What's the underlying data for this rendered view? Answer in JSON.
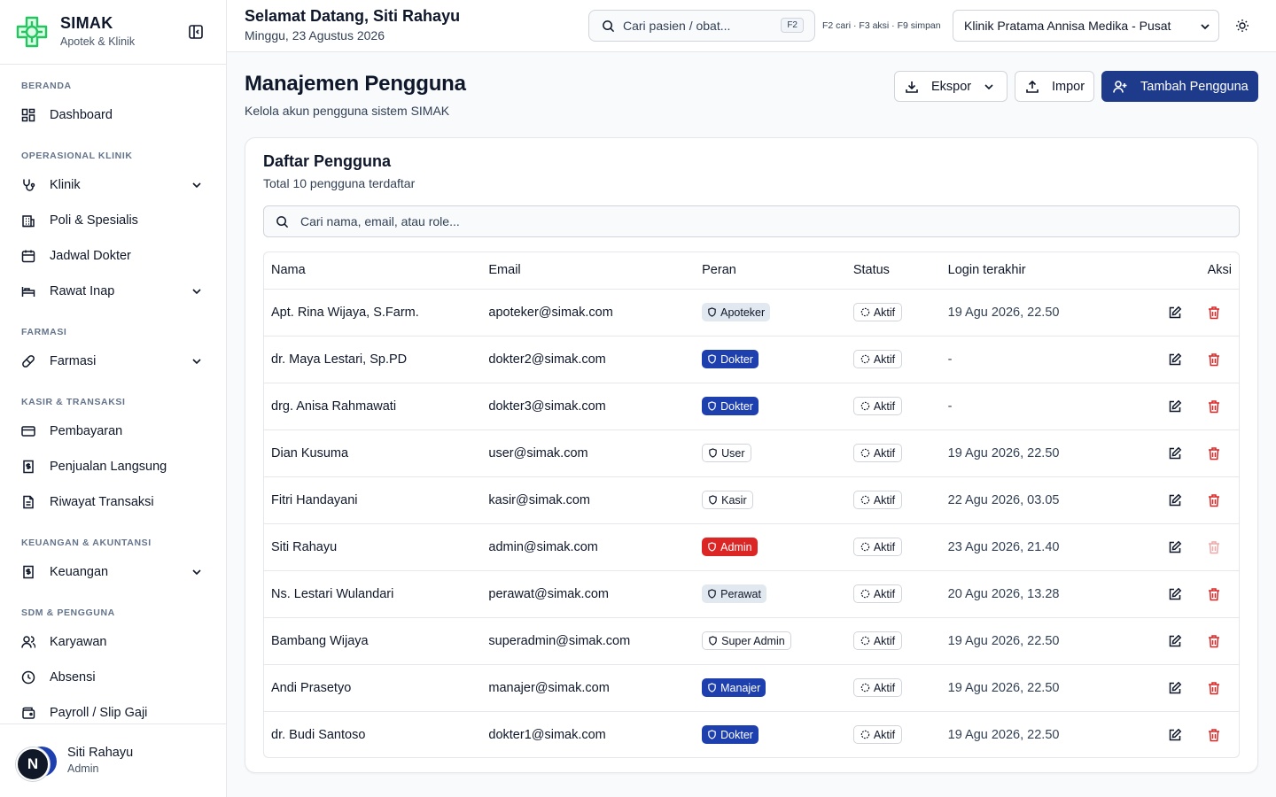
{
  "brand": {
    "name": "SIMAK",
    "subtitle": "Apotek & Klinik"
  },
  "sidebar": {
    "sections": [
      {
        "label": "BERANDA"
      },
      {
        "label": "OPERASIONAL KLINIK"
      },
      {
        "label": "FARMASI"
      },
      {
        "label": "KASIR & TRANSAKSI"
      },
      {
        "label": "KEUANGAN & AKUNTANSI"
      },
      {
        "label": "SDM & PENGGUNA"
      }
    ],
    "items": [
      {
        "label": "Dashboard",
        "icon": "dashboard-icon"
      },
      {
        "label": "Klinik",
        "icon": "stethoscope-icon",
        "expandable": true
      },
      {
        "label": "Poli & Spesialis",
        "icon": "building-icon"
      },
      {
        "label": "Jadwal Dokter",
        "icon": "calendar-icon"
      },
      {
        "label": "Rawat Inap",
        "icon": "bed-icon",
        "expandable": true
      },
      {
        "label": "Farmasi",
        "icon": "pill-icon",
        "expandable": true
      },
      {
        "label": "Pembayaran",
        "icon": "credit-card-icon"
      },
      {
        "label": "Penjualan Langsung",
        "icon": "receipt-dollar-icon"
      },
      {
        "label": "Riwayat Transaksi",
        "icon": "file-text-icon"
      },
      {
        "label": "Keuangan",
        "icon": "receipt-dollar-icon",
        "expandable": true
      },
      {
        "label": "Karyawan",
        "icon": "users-icon"
      },
      {
        "label": "Absensi",
        "icon": "clock-icon"
      },
      {
        "label": "Payroll / Slip Gaji",
        "icon": "wallet-icon"
      }
    ]
  },
  "user": {
    "name": "Siti Rahayu",
    "role": "Admin",
    "avatar_initial": "N"
  },
  "topbar": {
    "greeting": "Selamat Datang, Siti Rahayu",
    "date": "Minggu, 23 Agustus 2026",
    "search_placeholder": "Cari pasien / obat...",
    "search_kbd": "F2",
    "shortcuts_hint": "F2 cari · F3 aksi · F9 simpan",
    "clinic_selected": "Klinik Pratama Annisa Medika - Pusat"
  },
  "page": {
    "title": "Manajemen Pengguna",
    "subtitle": "Kelola akun pengguna sistem SIMAK",
    "export_label": "Ekspor",
    "import_label": "Impor",
    "add_label": "Tambah Pengguna"
  },
  "card": {
    "title": "Daftar Pengguna",
    "subtitle": "Total 10 pengguna terdaftar",
    "search_placeholder": "Cari nama, email, atau role..."
  },
  "table": {
    "headers": {
      "name": "Nama",
      "email": "Email",
      "role": "Peran",
      "status": "Status",
      "last_login": "Login terakhir",
      "actions": "Aksi"
    },
    "rows": [
      {
        "name": "Apt. Rina Wijaya, S.Farm.",
        "email": "apoteker@simak.com",
        "role": "Apoteker",
        "role_style": "apoteker",
        "status": "Aktif",
        "last_login": "19 Agu 2026, 22.50",
        "delete_disabled": false
      },
      {
        "name": "dr. Maya Lestari, Sp.PD",
        "email": "dokter2@simak.com",
        "role": "Dokter",
        "role_style": "dokter",
        "status": "Aktif",
        "last_login": "-",
        "delete_disabled": false
      },
      {
        "name": "drg. Anisa Rahmawati",
        "email": "dokter3@simak.com",
        "role": "Dokter",
        "role_style": "dokter",
        "status": "Aktif",
        "last_login": "-",
        "delete_disabled": false
      },
      {
        "name": "Dian Kusuma",
        "email": "user@simak.com",
        "role": "User",
        "role_style": "user",
        "status": "Aktif",
        "last_login": "19 Agu 2026, 22.50",
        "delete_disabled": false
      },
      {
        "name": "Fitri Handayani",
        "email": "kasir@simak.com",
        "role": "Kasir",
        "role_style": "kasir",
        "status": "Aktif",
        "last_login": "22 Agu 2026, 03.05",
        "delete_disabled": false
      },
      {
        "name": "Siti Rahayu",
        "email": "admin@simak.com",
        "role": "Admin",
        "role_style": "admin",
        "status": "Aktif",
        "last_login": "23 Agu 2026, 21.40",
        "delete_disabled": true
      },
      {
        "name": "Ns. Lestari Wulandari",
        "email": "perawat@simak.com",
        "role": "Perawat",
        "role_style": "perawat",
        "status": "Aktif",
        "last_login": "20 Agu 2026, 13.28",
        "delete_disabled": false
      },
      {
        "name": "Bambang Wijaya",
        "email": "superadmin@simak.com",
        "role": "Super Admin",
        "role_style": "superadmin",
        "status": "Aktif",
        "last_login": "19 Agu 2026, 22.50",
        "delete_disabled": false
      },
      {
        "name": "Andi Prasetyo",
        "email": "manajer@simak.com",
        "role": "Manajer",
        "role_style": "manajer",
        "status": "Aktif",
        "last_login": "19 Agu 2026, 22.50",
        "delete_disabled": false
      },
      {
        "name": "dr. Budi Santoso",
        "email": "dokter1@simak.com",
        "role": "Dokter",
        "role_style": "dokter",
        "status": "Aktif",
        "last_login": "19 Agu 2026, 22.50",
        "delete_disabled": false
      }
    ]
  },
  "colors": {
    "primary": "#1e3a8a",
    "brand_green": "#22c55e",
    "danger": "#dc2626",
    "badge_blue": "#1e40af"
  }
}
